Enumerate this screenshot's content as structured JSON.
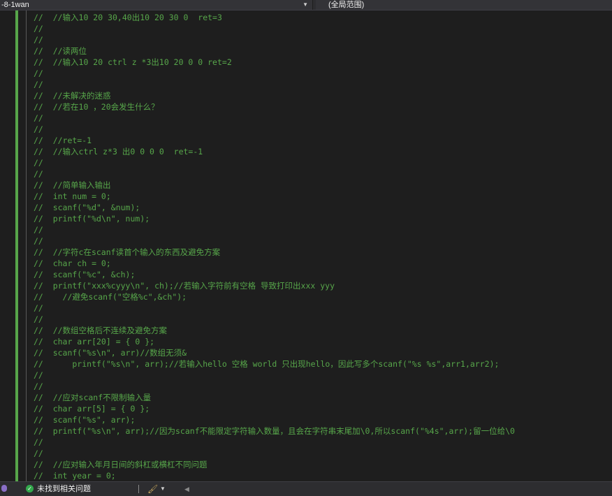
{
  "toolbar": {
    "file_dropdown": "-8-1wan",
    "scope_dropdown": "(全局范围)"
  },
  "editor": {
    "lines": [
      "//  //输入10 20 30,40出10 20 30 0  ret=3",
      "//",
      "//",
      "//  //读两位",
      "//  //输入10 20 ctrl z *3出10 20 0 0 ret=2",
      "//",
      "//",
      "//  //未解决的迷惑",
      "//  //若在10 ，20会发生什么？",
      "//",
      "//",
      "//  //ret=-1",
      "//  //输入ctrl z*3 出0 0 0 0  ret=-1",
      "//",
      "//",
      "//  //简单输入输出",
      "//  int num = 0;",
      "//  scanf(\"%d\", &num);",
      "//  printf(\"%d\\n\", num);",
      "//",
      "//",
      "//  //字符c在scanf读首个输入的东西及避免方案",
      "//  char ch = 0;",
      "//  scanf(\"%c\", &ch);",
      "//  printf(\"xxx%cyyy\\n\", ch);//若输入字符前有空格 导致打印出xxx yyy",
      "//    //避免scanf(\"空格%c\",&ch\");",
      "//",
      "//",
      "//  //数组空格后不连续及避免方案",
      "//  char arr[20] = { 0 };",
      "//  scanf(\"%s\\n\", arr)//数组无须&",
      "//      printf(\"%s\\n\", arr);//若输入hello 空格 world 只出现hello，因此写多个scanf(\"%s %s\",arr1,arr2);",
      "//",
      "//",
      "//  //应对scanf不限制输入量",
      "//  char arr[5] = { 0 };",
      "//  scanf(\"%s\", arr);",
      "//  printf(\"%s\\n\", arr);//因为scanf不能限定字符输入数量，且会在字符串末尾加\\0,所以scanf(\"%4s\",arr);留一位给\\0",
      "//",
      "//",
      "//  //应对输入年月日间的斜杠或横杠不同问题",
      "//  int year = 0;"
    ]
  },
  "status": {
    "issues_text": "未找到相关问题"
  },
  "icons": {
    "check": "check-circle-icon",
    "brush": "cleanup-brush-icon"
  }
}
